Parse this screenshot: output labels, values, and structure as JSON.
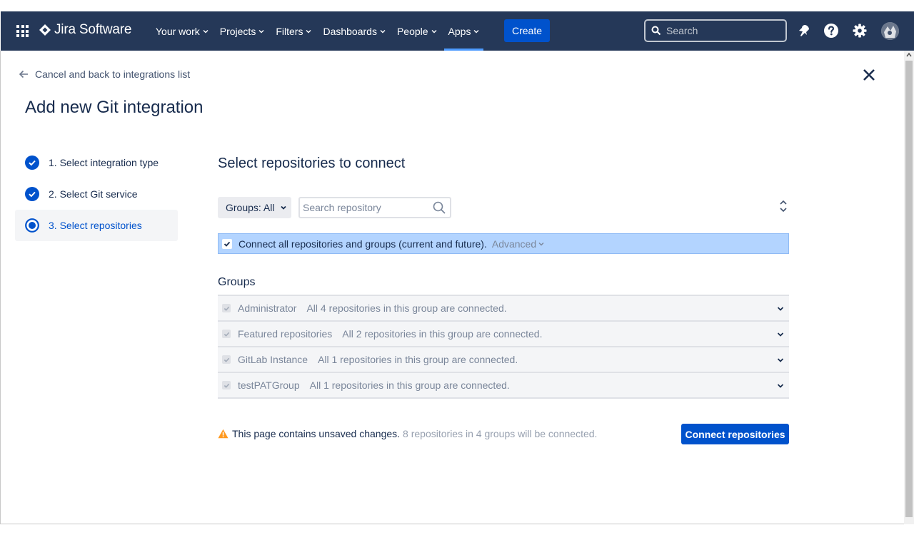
{
  "nav": {
    "product_name": "Jira Software",
    "items": [
      {
        "label": "Your work",
        "active": false
      },
      {
        "label": "Projects",
        "active": false
      },
      {
        "label": "Filters",
        "active": false
      },
      {
        "label": "Dashboards",
        "active": false
      },
      {
        "label": "People",
        "active": false
      },
      {
        "label": "Apps",
        "active": true
      }
    ],
    "create_label": "Create",
    "search_placeholder": "Search",
    "icons": [
      "app-switcher-icon",
      "jira-logo-icon",
      "notifications-icon",
      "help-icon",
      "settings-icon",
      "avatar"
    ]
  },
  "page": {
    "back_label": "Cancel and back to integrations list",
    "title": "Add new Git integration",
    "steps": [
      {
        "label": "1. Select integration type",
        "state": "done"
      },
      {
        "label": "2. Select Git service",
        "state": "done"
      },
      {
        "label": "3. Select repositories",
        "state": "current"
      }
    ],
    "section_title": "Select repositories to connect",
    "groups_filter_label": "Groups: All",
    "repo_search_placeholder": "Search repository",
    "connect_all_label": "Connect all repositories and groups (current and future).",
    "advanced_label": "Advanced",
    "groups_heading": "Groups",
    "groups": [
      {
        "name": "Administrator",
        "status": "All 4 repositories in this group are connected."
      },
      {
        "name": "Featured repositories",
        "status": "All 2 repositories in this group are connected."
      },
      {
        "name": "GitLab Instance",
        "status": "All 1 repositories in this group are connected."
      },
      {
        "name": "testPATGroup",
        "status": "All 1 repositories in this group are connected."
      }
    ],
    "unsaved_warning": "This page contains unsaved changes.",
    "unsaved_detail": "8 repositories in 4 groups will be connected.",
    "connect_button_label": "Connect repositories"
  },
  "colors": {
    "nav_bg": "#253858",
    "primary": "#0052cc",
    "selection_bg": "#b3d4ff",
    "warning": "#ff991f"
  }
}
